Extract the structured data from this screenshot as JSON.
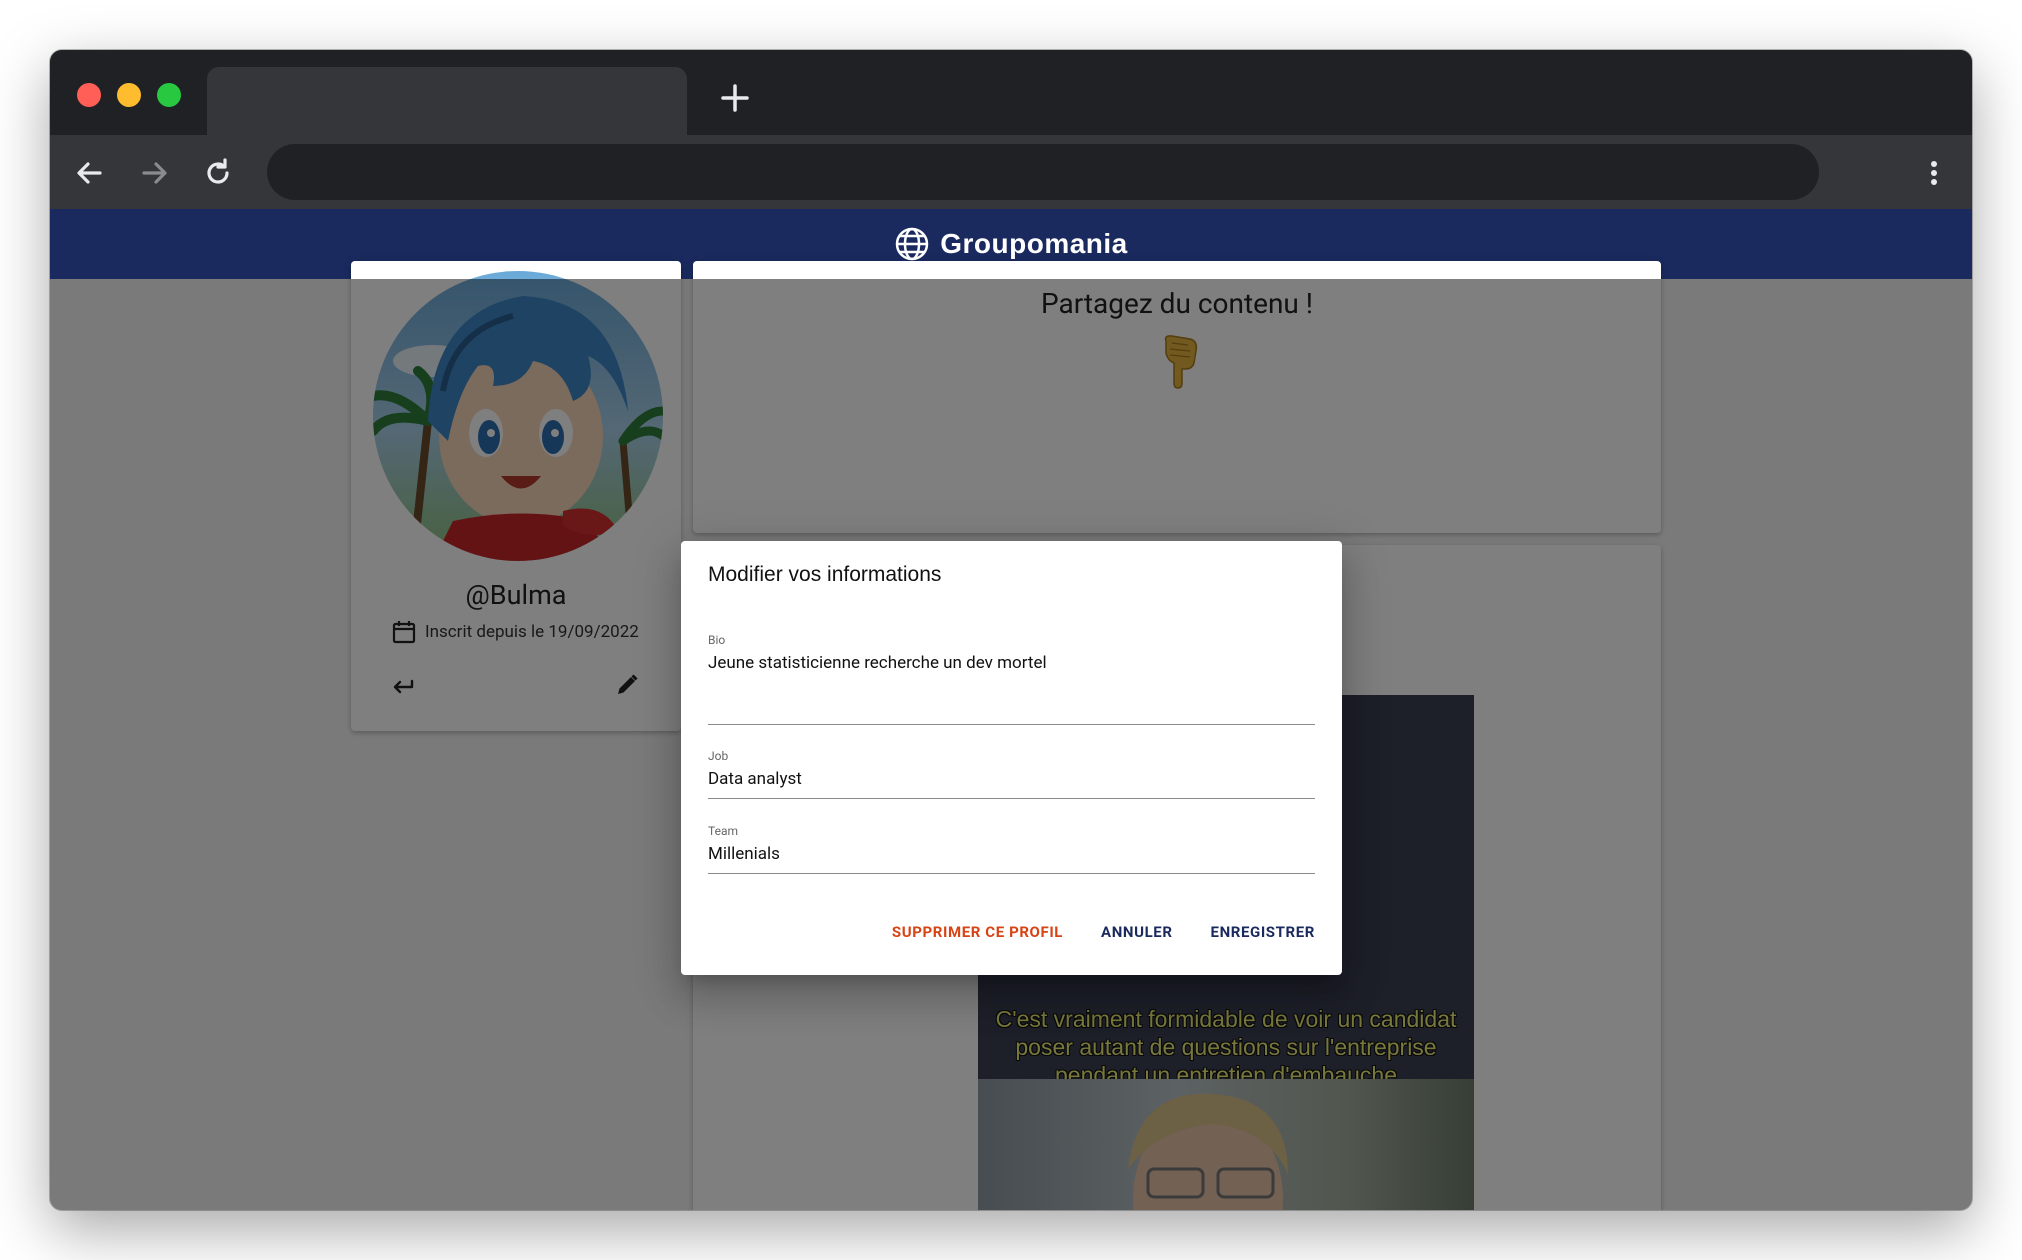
{
  "app": {
    "brand": "Groupomania",
    "brand_icon": "globe-icon",
    "colors": {
      "appbar": "#1a2a5e",
      "danger": "#d84315",
      "primary": "#1a2a5e"
    }
  },
  "profile": {
    "username": "@Bulma",
    "joined": "Inscrit depuis le 19/09/2022"
  },
  "feed": {
    "share_title": "Partagez du contenu !",
    "share_emoji": "🫵👇",
    "meme_caption": [
      "C'est vraiment formidable de voir un candidat",
      "poser autant de questions sur l'entreprise",
      "pendant un entretien d'embauche"
    ]
  },
  "dialog": {
    "title": "Modifier vos informations",
    "fields": {
      "bio": {
        "label": "Bio",
        "value": "Jeune statisticienne recherche un dev mortel"
      },
      "job": {
        "label": "Job",
        "value": "Data analyst"
      },
      "team": {
        "label": "Team",
        "value": "Millenials"
      }
    },
    "actions": {
      "delete": "Supprimer ce profil",
      "cancel": "Annuler",
      "save": "Enregistrer"
    }
  }
}
